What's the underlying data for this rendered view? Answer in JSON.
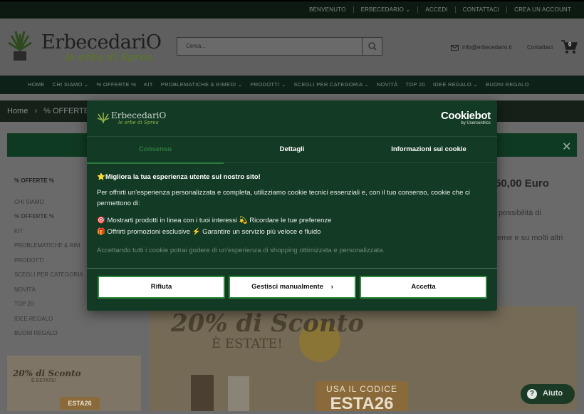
{
  "topbar": {
    "links": [
      "BENVENUTO",
      "ERBECEDARIO ⌄",
      "ACCEDI",
      "CONTATTACI",
      "CREA UN ACCOUNT"
    ]
  },
  "header": {
    "logo_name": "ErbecedariO",
    "logo_tagline": "le erbe di Sprea",
    "search_placeholder": "Cerca...",
    "email": "info@erbecedario.it",
    "contact_label": "Contattaci",
    "cart_count": "0"
  },
  "nav": {
    "items": [
      "HOME",
      "CHI SIAMO ⌄",
      "% OFFERTE %",
      "KIT",
      "PROBLEMATICHE & RIMEDI ⌄",
      "PRODOTTI ⌄",
      "SCEGLI PER CATEGORIA ⌄",
      "NOVITÀ",
      "TOP 20",
      "IDEE REGALO ⌄",
      "BUONI REGALO"
    ]
  },
  "breadcrumb": {
    "home": "Home",
    "sep": "›",
    "current": "% OFFERTE"
  },
  "sidebar": {
    "title": "% OFFERTE %",
    "items": [
      "CHI SIAMO",
      "% OFFERTE %",
      "KIT",
      "PROBLEMATICHE & RIM",
      "PRODOTTI",
      "SCEGLI PER CATEGORIA",
      "NOVITÀ",
      "TOP 20",
      "IDEE REGALO",
      "BUONI REGALO"
    ]
  },
  "content": {
    "price": "50,00 Euro",
    "text1": "possibilità di",
    "text2": "eme e su molti altri"
  },
  "banner": {
    "headline": "20% di Sconto",
    "subline": "È ESTATE!",
    "code_label": "USA IL CODICE",
    "code": "ESTA26",
    "small_headline": "20% di Sconto",
    "small_subline": "È ESTATE!",
    "small_code": "ESTA26"
  },
  "help": {
    "label": "Aiuto"
  },
  "cookie": {
    "logo_name": "ErbecedariO",
    "logo_tagline": "le erbe di Sprea",
    "brand": "Cookiebot",
    "brand_sub": "by Usercentrics",
    "tabs": [
      "Consenso",
      "Dettagli",
      "Informazioni sui cookie"
    ],
    "heading": "⭐Migliora la tua esperienza utente sul nostro sito!",
    "paragraph": "Per offrirti un'esperienza personalizzata e completa, utilizziamo cookie tecnici essenziali e, con il tuo consenso, cookie che ci permettono di:",
    "line1": "🎯 Mostrarti prodotti in linea con i tuoi interessi 💫 Ricordare le tue preferenze",
    "line2": "🎁 Offrirti promozioni esclusive ⚡ Garantire un servizio più veloce e fluido",
    "fade": "Accettando tutti i cookie potrai godere di un'esperienza di shopping ottimizzata e personalizzata.",
    "btn_reject": "Rifiuta",
    "btn_manage": "Gestisci manualmente",
    "btn_accept": "Accetta"
  },
  "colors": {
    "brand_green": "#133a24",
    "accent_green": "#2d7b3f",
    "nav_dark": "#0d2118"
  }
}
